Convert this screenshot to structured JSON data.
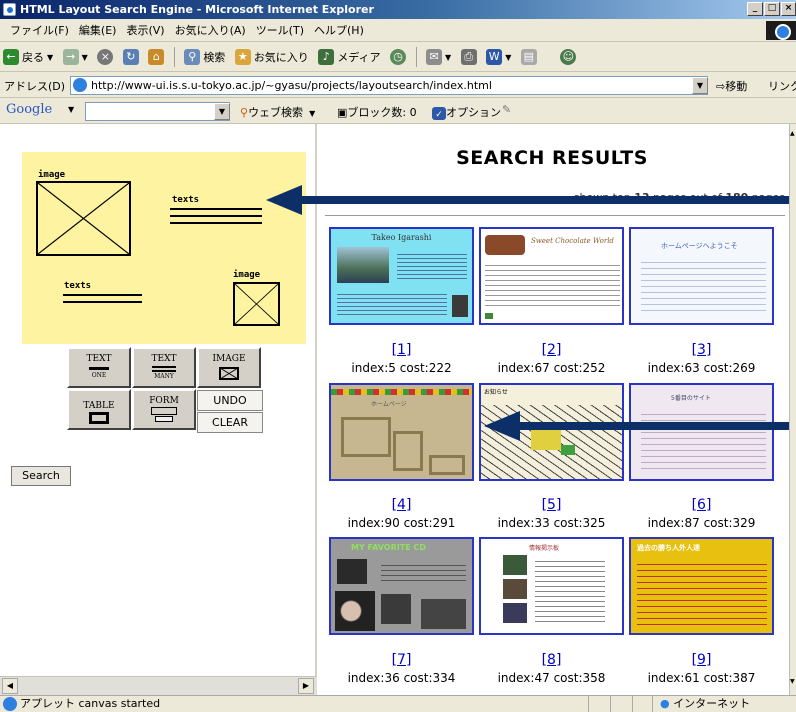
{
  "window": {
    "title": "HTML Layout Search Engine - Microsoft Internet Explorer",
    "min": "_",
    "max": "□",
    "close": "×"
  },
  "menu": [
    "ファイル(F)",
    "編集(E)",
    "表示(V)",
    "お気に入り(A)",
    "ツール(T)",
    "ヘルプ(H)"
  ],
  "toolbar": {
    "back": "戻る",
    "search": "検索",
    "favorites": "お気に入り",
    "media": "メディア"
  },
  "address": {
    "label": "アドレス(D)",
    "url": "http://www-ui.is.s.u-tokyo.ac.jp/~gyasu/projects/layoutsearch/index.html",
    "go": "移動",
    "links": "リンク"
  },
  "google": {
    "logo": "Google",
    "web_search": "ウェブ検索",
    "popup_blocked": "ブロック数: 0",
    "options": "オプション"
  },
  "canvas": {
    "image_label_1": "image",
    "texts_label_1": "texts",
    "texts_label_2": "texts",
    "image_label_2": "image"
  },
  "palette": [
    {
      "label": "TEXT",
      "sub": "ONE",
      "icon": "text-one"
    },
    {
      "label": "TEXT",
      "sub": "MANY",
      "icon": "text-many"
    },
    {
      "label": "IMAGE",
      "sub": "",
      "icon": "image"
    },
    {
      "label": "TABLE",
      "sub": "",
      "icon": "table"
    },
    {
      "label": "FORM",
      "sub": "",
      "icon": "form"
    }
  ],
  "controls": {
    "undo": "UNDO",
    "clear": "CLEAR",
    "search": "Search"
  },
  "results": {
    "title": "SEARCH RESULTS",
    "subtitle_parts": [
      "shown top ",
      "13",
      " pages out of ",
      "180",
      " pages"
    ],
    "items": [
      {
        "rank": "[1]",
        "index": "index:5",
        "cost": "cost:222",
        "thumb": "cyan"
      },
      {
        "rank": "[2]",
        "index": "index:67",
        "cost": "cost:252",
        "thumb": "white"
      },
      {
        "rank": "[3]",
        "index": "index:63",
        "cost": "cost:269",
        "thumb": "light"
      },
      {
        "rank": "[4]",
        "index": "index:90",
        "cost": "cost:291",
        "thumb": "tan"
      },
      {
        "rank": "[5]",
        "index": "index:33",
        "cost": "cost:325",
        "thumb": "map"
      },
      {
        "rank": "[6]",
        "index": "index:87",
        "cost": "cost:329",
        "thumb": "pink"
      },
      {
        "rank": "[7]",
        "index": "index:36",
        "cost": "cost:334",
        "thumb": "gray"
      },
      {
        "rank": "[8]",
        "index": "index:47",
        "cost": "cost:358",
        "thumb": "white2"
      },
      {
        "rank": "[9]",
        "index": "index:61",
        "cost": "cost:387",
        "thumb": "gold"
      }
    ]
  },
  "thumb_texts": {
    "t1": "Takeo Igarashi",
    "t2": "Sweet Chocolate World",
    "t3": "ホームページへようこそ",
    "t4": "ホームページ",
    "t5": "お知らせ",
    "t6": "5番目のサイト",
    "t7": "MY FAVORITE CD",
    "t8": "情報掲示板",
    "t9": "過去の勝ち人外人達"
  },
  "status": {
    "text": "アプレット canvas started",
    "zone": "インターネット"
  },
  "colors": {
    "canvas_bg": "#fdf3a1",
    "thumb_border": "#2a35c8",
    "arrow": "#0c2f68",
    "link": "#0000cc"
  }
}
